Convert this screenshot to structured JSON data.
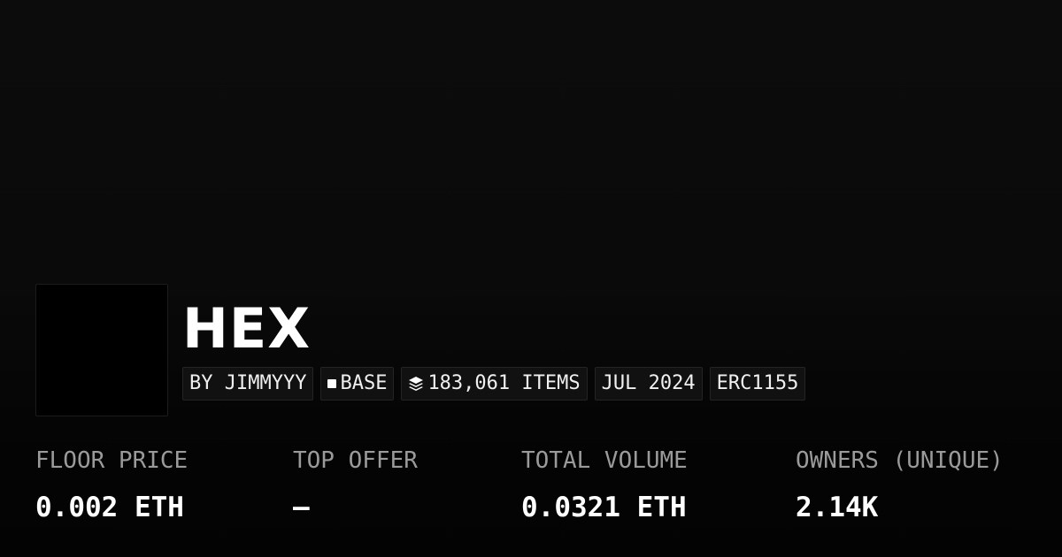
{
  "collection": {
    "name": "HEX",
    "creator": "BY JIMMYYY",
    "chain": "BASE",
    "items": "183,061 ITEMS",
    "date": "JUL 2024",
    "standard": "ERC1155"
  },
  "icons": {
    "chain": "base-chain-icon",
    "items": "layers-icon"
  },
  "stats": [
    {
      "label": "FLOOR PRICE",
      "value": "0.002 ETH"
    },
    {
      "label": "TOP OFFER",
      "value": "–"
    },
    {
      "label": "TOTAL VOLUME",
      "value": "0.0321 ETH"
    },
    {
      "label": "OWNERS (UNIQUE)",
      "value": "2.14K"
    }
  ],
  "colors": {
    "background": "#0a0a0a",
    "text": "#ffffff",
    "label": "#9a9a9a",
    "tag_background": "#111111"
  }
}
